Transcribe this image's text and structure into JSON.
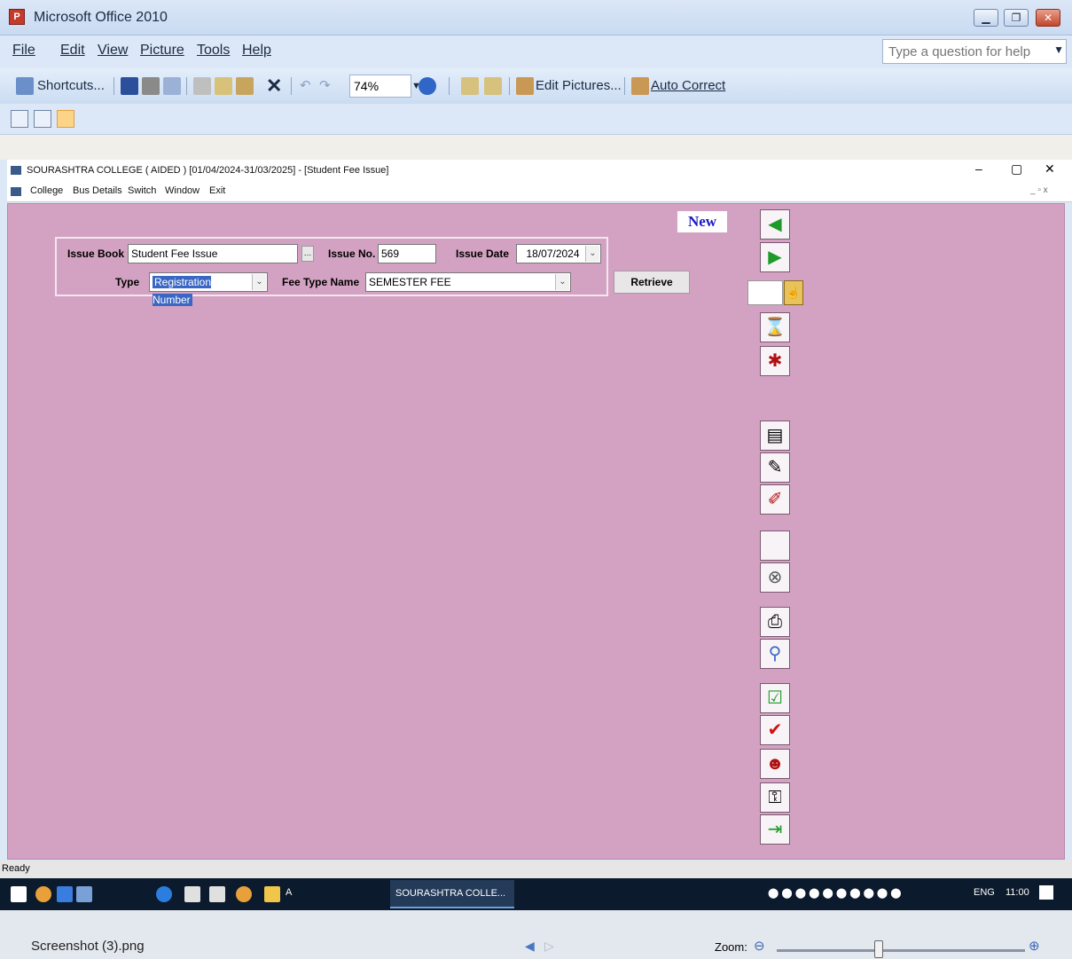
{
  "office": {
    "title": "Microsoft Office 2010",
    "app_icon": "office-picture-icon",
    "window_buttons": [
      "_",
      "❐",
      "✕"
    ]
  },
  "menubar": {
    "items": [
      {
        "label": "File"
      },
      {
        "label": "Edit"
      },
      {
        "label": "View"
      },
      {
        "label": "Picture"
      },
      {
        "label": "Tools"
      },
      {
        "label": "Help"
      }
    ],
    "help_placeholder": "Type a question for help"
  },
  "toolbar": {
    "shortcuts_label": "Shortcuts...",
    "zoom_value": "74%",
    "edit_pictures_label": "Edit Pictures...",
    "auto_correct_label": "Auto Correct"
  },
  "inner_window": {
    "title": "SOURASHTRA COLLEGE ( AIDED ) [01/04/2024-31/03/2025] - [Student Fee Issue]",
    "menu": [
      "College",
      "Bus Details",
      "Switch",
      "Window",
      "Exit"
    ],
    "controls": [
      "–",
      "▢",
      "✕"
    ]
  },
  "form": {
    "mode_label": "New",
    "issue_book_label": "Issue Book",
    "issue_book_value": "Student Fee Issue",
    "issue_no_label": "Issue No.",
    "issue_no_value": "569",
    "issue_date_label": "Issue Date",
    "issue_date_value": "18/07/2024",
    "type_label": "Type",
    "type_value": "Registration Number",
    "fee_type_label": "Fee Type Name",
    "fee_type_value": "SEMESTER FEE",
    "retrieve_label": "Retrieve"
  },
  "status": {
    "text": "Ready"
  },
  "taskbar": {
    "app_label": "SOURASHTRA COLLE...",
    "pinned_label": "A",
    "lang": "ENG",
    "time": "11:00"
  },
  "viewer": {
    "file_name": "Screenshot (3).png",
    "zoom_label": "Zoom:"
  },
  "colors": {
    "workspace": "#d3a2c2",
    "new_label": "#1a1ac8"
  }
}
